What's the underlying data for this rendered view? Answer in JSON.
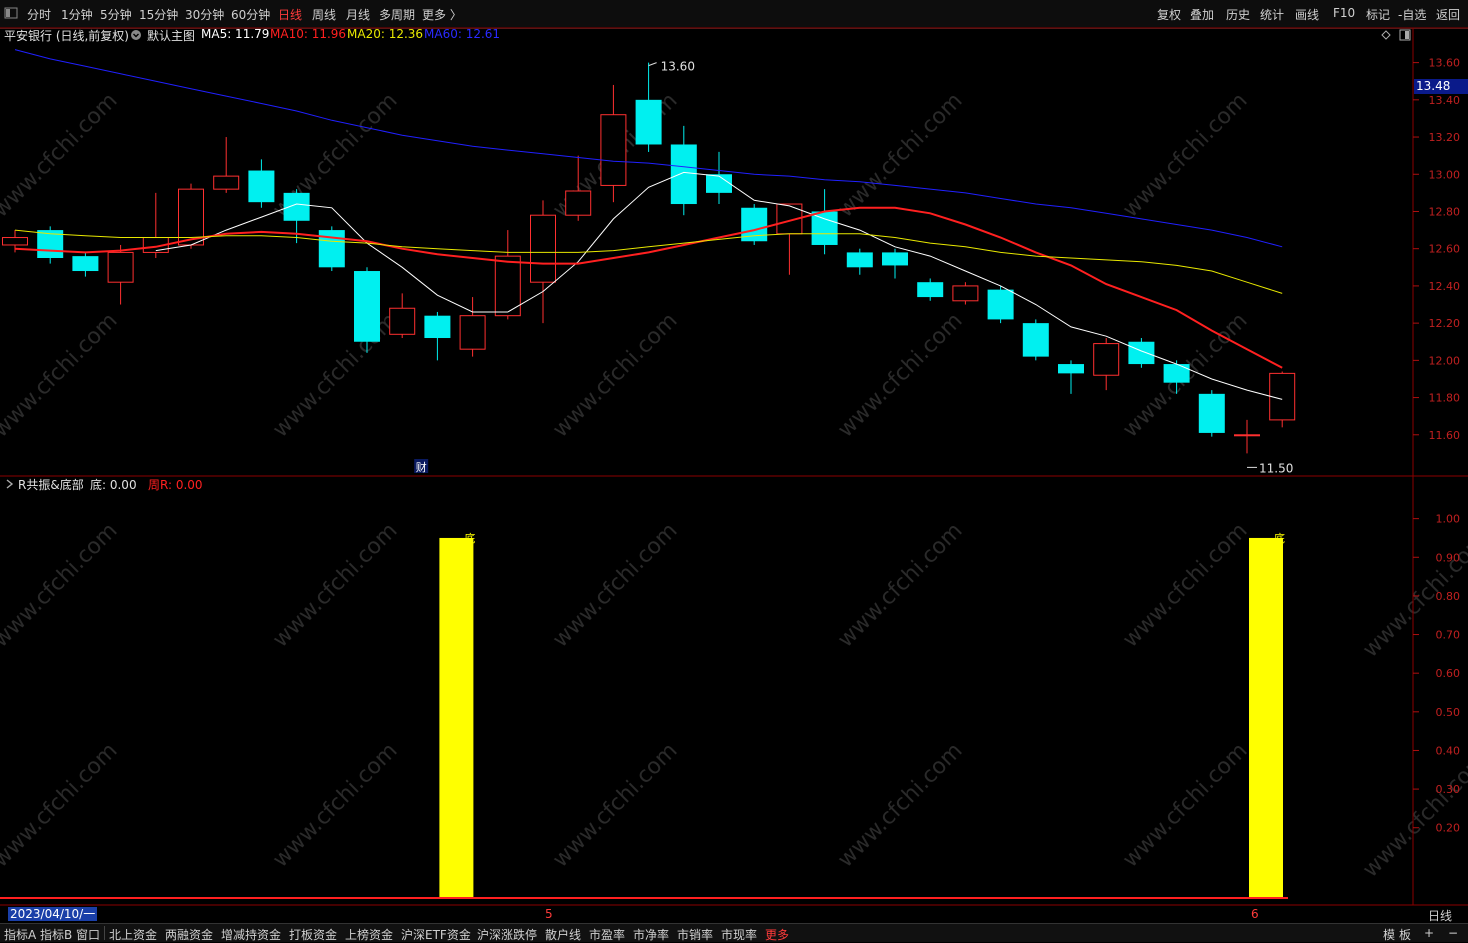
{
  "toolbar": {
    "left_icon": "hide-panel-icon",
    "periods": [
      "分时",
      "1分钟",
      "5分钟",
      "15分钟",
      "30分钟",
      "60分钟",
      "日线",
      "周线",
      "月线",
      "多周期",
      "更多 〉"
    ],
    "active_period": "日线",
    "right": [
      "复权",
      "叠加",
      "历史",
      "统计",
      "画线",
      "F10",
      "标记",
      "-自选",
      "返回"
    ]
  },
  "info": {
    "stock": "平安银行 (日线,前复权)",
    "template_icon": "circle-menu-icon",
    "template": "默认主图",
    "ma5": "MA5: 11.79",
    "ma10": "MA10: 11.96",
    "ma20": "MA20: 12.36",
    "ma60": "MA60: 12.61",
    "colors": {
      "ma5": "#ffffff",
      "ma10": "#ff2020",
      "ma20": "#e8e800",
      "ma60": "#2020ff"
    }
  },
  "indicator": {
    "name": "R共振&底部",
    "di": "底: 0.00",
    "zhou": "周R: 0.00",
    "bar_label": "底"
  },
  "current_price_tag": "13.48",
  "max_label": "13.60",
  "min_label": "11.50",
  "fin_marker": "财",
  "date_box": "2023/04/10/一",
  "month_marks": [
    "5",
    "6"
  ],
  "period_label": "日线",
  "bottom_tabs": [
    "指标A",
    "指标B",
    "窗口",
    "北上资金",
    "两融资金",
    "增减持资金",
    "打板资金",
    "上榜资金",
    "沪深ETF资金",
    "沪深涨跌停",
    "散户线",
    "市盈率",
    "市净率",
    "市销率",
    "市现率",
    "更多"
  ],
  "bottom_right": [
    "模",
    "板",
    "+",
    "−"
  ],
  "watermark": "www.cfchi.com",
  "chart_data": [
    {
      "type": "candlestick",
      "title": "平安银行 (日线,前复权)",
      "yticks": [
        "13.60",
        "13.40",
        "13.20",
        "13.00",
        "12.80",
        "12.60",
        "12.40",
        "12.20",
        "12.00",
        "11.80",
        "11.60"
      ],
      "ylim": [
        11.4,
        13.7
      ],
      "candles": [
        {
          "o": 12.62,
          "h": 12.7,
          "l": 12.58,
          "c": 12.66
        },
        {
          "o": 12.7,
          "h": 12.72,
          "l": 12.52,
          "c": 12.55
        },
        {
          "o": 12.56,
          "h": 12.58,
          "l": 12.45,
          "c": 12.48
        },
        {
          "o": 12.42,
          "h": 12.62,
          "l": 12.3,
          "c": 12.58
        },
        {
          "o": 12.58,
          "h": 12.9,
          "l": 12.55,
          "c": 12.66
        },
        {
          "o": 12.62,
          "h": 12.95,
          "l": 12.6,
          "c": 12.92
        },
        {
          "o": 12.92,
          "h": 13.2,
          "l": 12.9,
          "c": 12.99
        },
        {
          "o": 13.02,
          "h": 13.08,
          "l": 12.82,
          "c": 12.85
        },
        {
          "o": 12.9,
          "h": 12.92,
          "l": 12.63,
          "c": 12.75
        },
        {
          "o": 12.7,
          "h": 12.72,
          "l": 12.48,
          "c": 12.5
        },
        {
          "o": 12.48,
          "h": 12.5,
          "l": 12.04,
          "c": 12.1
        },
        {
          "o": 12.14,
          "h": 12.36,
          "l": 12.12,
          "c": 12.28
        },
        {
          "o": 12.24,
          "h": 12.26,
          "l": 12.0,
          "c": 12.12
        },
        {
          "o": 12.06,
          "h": 12.34,
          "l": 12.02,
          "c": 12.24
        },
        {
          "o": 12.24,
          "h": 12.7,
          "l": 12.22,
          "c": 12.56
        },
        {
          "o": 12.42,
          "h": 12.86,
          "l": 12.2,
          "c": 12.78
        },
        {
          "o": 12.78,
          "h": 13.1,
          "l": 12.75,
          "c": 12.91
        },
        {
          "o": 12.94,
          "h": 13.48,
          "l": 12.85,
          "c": 13.32
        },
        {
          "o": 13.4,
          "h": 13.6,
          "l": 13.12,
          "c": 13.16
        },
        {
          "o": 13.16,
          "h": 13.26,
          "l": 12.78,
          "c": 12.84
        },
        {
          "o": 13.0,
          "h": 13.12,
          "l": 12.84,
          "c": 12.9
        },
        {
          "o": 12.82,
          "h": 12.84,
          "l": 12.62,
          "c": 12.64
        },
        {
          "o": 12.68,
          "h": 12.84,
          "l": 12.46,
          "c": 12.84
        },
        {
          "o": 12.8,
          "h": 12.92,
          "l": 12.57,
          "c": 12.62
        },
        {
          "o": 12.58,
          "h": 12.6,
          "l": 12.46,
          "c": 12.5
        },
        {
          "o": 12.58,
          "h": 12.6,
          "l": 12.44,
          "c": 12.51
        },
        {
          "o": 12.42,
          "h": 12.44,
          "l": 12.32,
          "c": 12.34
        },
        {
          "o": 12.32,
          "h": 12.42,
          "l": 12.3,
          "c": 12.4
        },
        {
          "o": 12.38,
          "h": 12.4,
          "l": 12.2,
          "c": 12.22
        },
        {
          "o": 12.2,
          "h": 12.22,
          "l": 12.0,
          "c": 12.02
        },
        {
          "o": 11.98,
          "h": 12.0,
          "l": 11.82,
          "c": 11.93
        },
        {
          "o": 11.92,
          "h": 12.12,
          "l": 11.84,
          "c": 12.09
        },
        {
          "o": 12.1,
          "h": 12.12,
          "l": 11.96,
          "c": 11.98
        },
        {
          "o": 11.98,
          "h": 12.0,
          "l": 11.82,
          "c": 11.88
        },
        {
          "o": 11.82,
          "h": 11.84,
          "l": 11.59,
          "c": 11.61
        },
        {
          "o": 11.6,
          "h": 11.68,
          "l": 11.5,
          "c": 11.6
        },
        {
          "o": 11.68,
          "h": 11.94,
          "l": 11.64,
          "c": 11.93
        }
      ],
      "series": [
        {
          "name": "MA5",
          "color": "#ffffff",
          "values": [
            null,
            null,
            null,
            null,
            12.59,
            12.62,
            12.7,
            12.77,
            12.84,
            12.82,
            12.63,
            12.5,
            12.35,
            12.26,
            12.26,
            12.37,
            12.53,
            12.76,
            12.93,
            13.01,
            12.99,
            12.86,
            12.83,
            12.76,
            12.7,
            12.61,
            12.56,
            12.48,
            12.4,
            12.3,
            12.18,
            12.13,
            12.05,
            11.98,
            11.9,
            11.84,
            11.79
          ]
        },
        {
          "name": "MA10",
          "color": "#ff2020",
          "values": [
            12.6,
            12.6,
            12.59,
            12.58,
            12.59,
            12.61,
            12.65,
            12.68,
            12.69,
            12.68,
            12.66,
            12.64,
            12.6,
            12.57,
            12.55,
            12.53,
            12.52,
            12.52,
            12.55,
            12.58,
            12.62,
            12.66,
            12.7,
            12.75,
            12.8,
            12.82,
            12.82,
            12.79,
            12.73,
            12.66,
            12.58,
            12.51,
            12.41,
            12.34,
            12.27,
            12.16,
            12.06,
            11.96
          ]
        },
        {
          "name": "MA20",
          "color": "#e8e800",
          "values": [
            12.72,
            12.7,
            12.68,
            12.67,
            12.66,
            12.66,
            12.66,
            12.67,
            12.67,
            12.66,
            12.64,
            12.63,
            12.61,
            12.6,
            12.59,
            12.58,
            12.58,
            12.58,
            12.59,
            12.61,
            12.63,
            12.65,
            12.67,
            12.68,
            12.68,
            12.68,
            12.66,
            12.63,
            12.61,
            12.58,
            12.56,
            12.55,
            12.54,
            12.53,
            12.51,
            12.48,
            12.42,
            12.36
          ]
        },
        {
          "name": "MA60",
          "color": "#2020ff",
          "values": [
            13.72,
            13.67,
            13.62,
            13.58,
            13.54,
            13.5,
            13.46,
            13.42,
            13.38,
            13.34,
            13.29,
            13.25,
            13.21,
            13.18,
            13.15,
            13.13,
            13.11,
            13.09,
            13.07,
            13.06,
            13.04,
            13.02,
            13.0,
            12.99,
            12.97,
            12.96,
            12.94,
            12.92,
            12.9,
            12.87,
            12.84,
            12.82,
            12.79,
            12.76,
            12.73,
            12.7,
            12.66,
            12.61
          ]
        }
      ]
    },
    {
      "type": "bar",
      "title": "R共振&底部",
      "yticks": [
        "1.00",
        "0.90",
        "0.80",
        "0.70",
        "0.60",
        "0.50",
        "0.40",
        "0.30",
        "0.20"
      ],
      "ylim": [
        0,
        1.1
      ],
      "bars": [
        {
          "index": 12,
          "value": 0.95
        },
        {
          "index": 35,
          "value": 0.95
        }
      ],
      "bar_color": "#ffff00"
    }
  ]
}
